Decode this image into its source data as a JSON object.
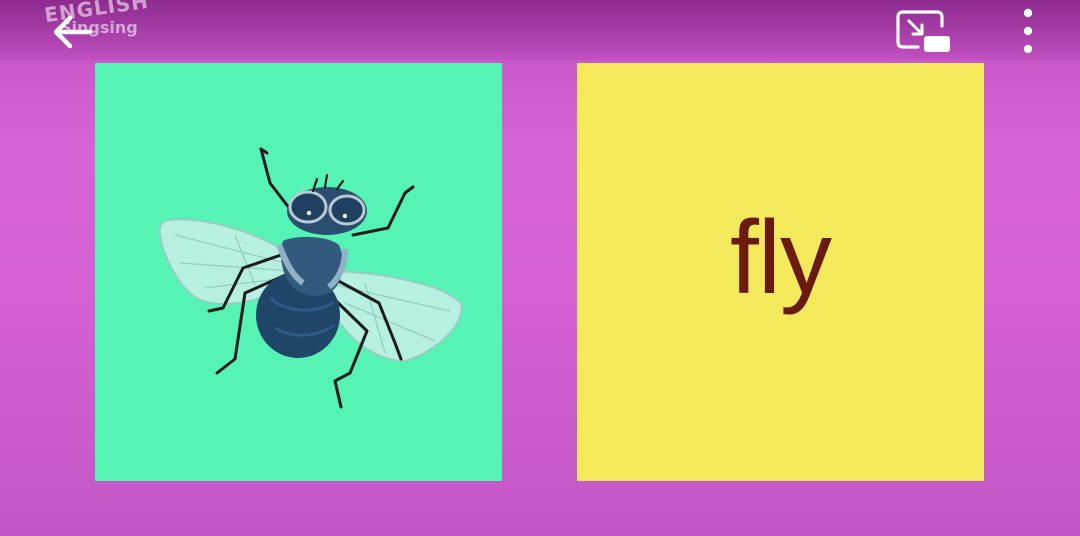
{
  "header": {
    "watermark": {
      "line1": "ENGLISH",
      "line2": "Singsing"
    },
    "icons": {
      "back": "arrow-left-icon",
      "pip": "picture-in-picture-exit-icon",
      "more": "more-vertical-icon"
    }
  },
  "flashcards": {
    "image_card": {
      "picture": "fly-illustration",
      "background": "#56f4b4"
    },
    "word_card": {
      "word": "fly",
      "background": "#f5e95c",
      "text_color": "#6b1a10"
    }
  },
  "colors": {
    "page_background": "#d35fd2",
    "icon_color": "#ffffff"
  }
}
